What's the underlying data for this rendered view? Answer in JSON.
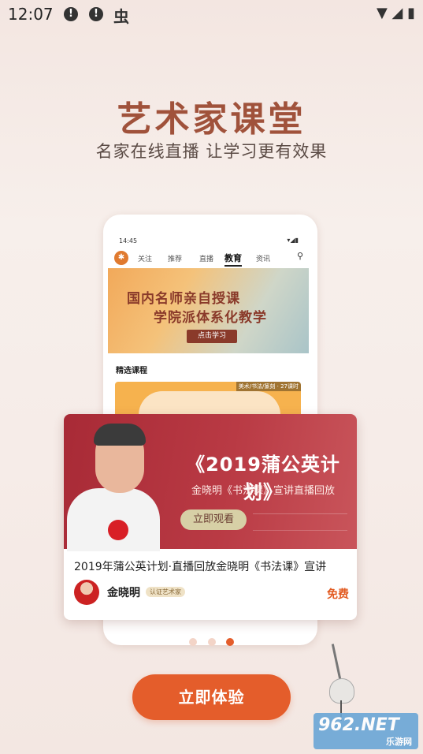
{
  "status_bar": {
    "time": "12:07",
    "icons": [
      "alert-icon",
      "alert-icon",
      "bug-icon",
      "wifi-icon",
      "signal-icon",
      "battery-icon"
    ]
  },
  "hero": {
    "title": "艺术家课堂",
    "subtitle": "名家在线直播 让学习更有效果"
  },
  "phone_preview": {
    "time": "14:45",
    "nav_tabs": [
      "关注",
      "推荐",
      "直播",
      "教育",
      "资讯"
    ],
    "active_tab": "教育",
    "banner": {
      "line1": "国内名师亲自授课",
      "line2": "学院派体系化教学",
      "button": "点击学习"
    },
    "section_title": "精选课程",
    "course_tag": "美术/书法/篆刻 · 27课时"
  },
  "course_card": {
    "banner_title": "《2019蒲公英计划》",
    "banner_subtitle": "金晓明《书法课》宣讲直播回放",
    "banner_button": "立即观看",
    "title": "2019年蒲公英计划·直播回放金晓明《书法课》宣讲",
    "teacher_name": "金晓明",
    "teacher_badge": "认证艺术家",
    "price_label": "免费"
  },
  "pager": {
    "count": 3,
    "active_index": 2
  },
  "cta": {
    "label": "立即体验"
  },
  "watermark": {
    "brand": "962.NET",
    "sub": "乐游网"
  },
  "colors": {
    "accent": "#e45d2b",
    "title": "#a0523b",
    "banner": "#b12f3b"
  }
}
